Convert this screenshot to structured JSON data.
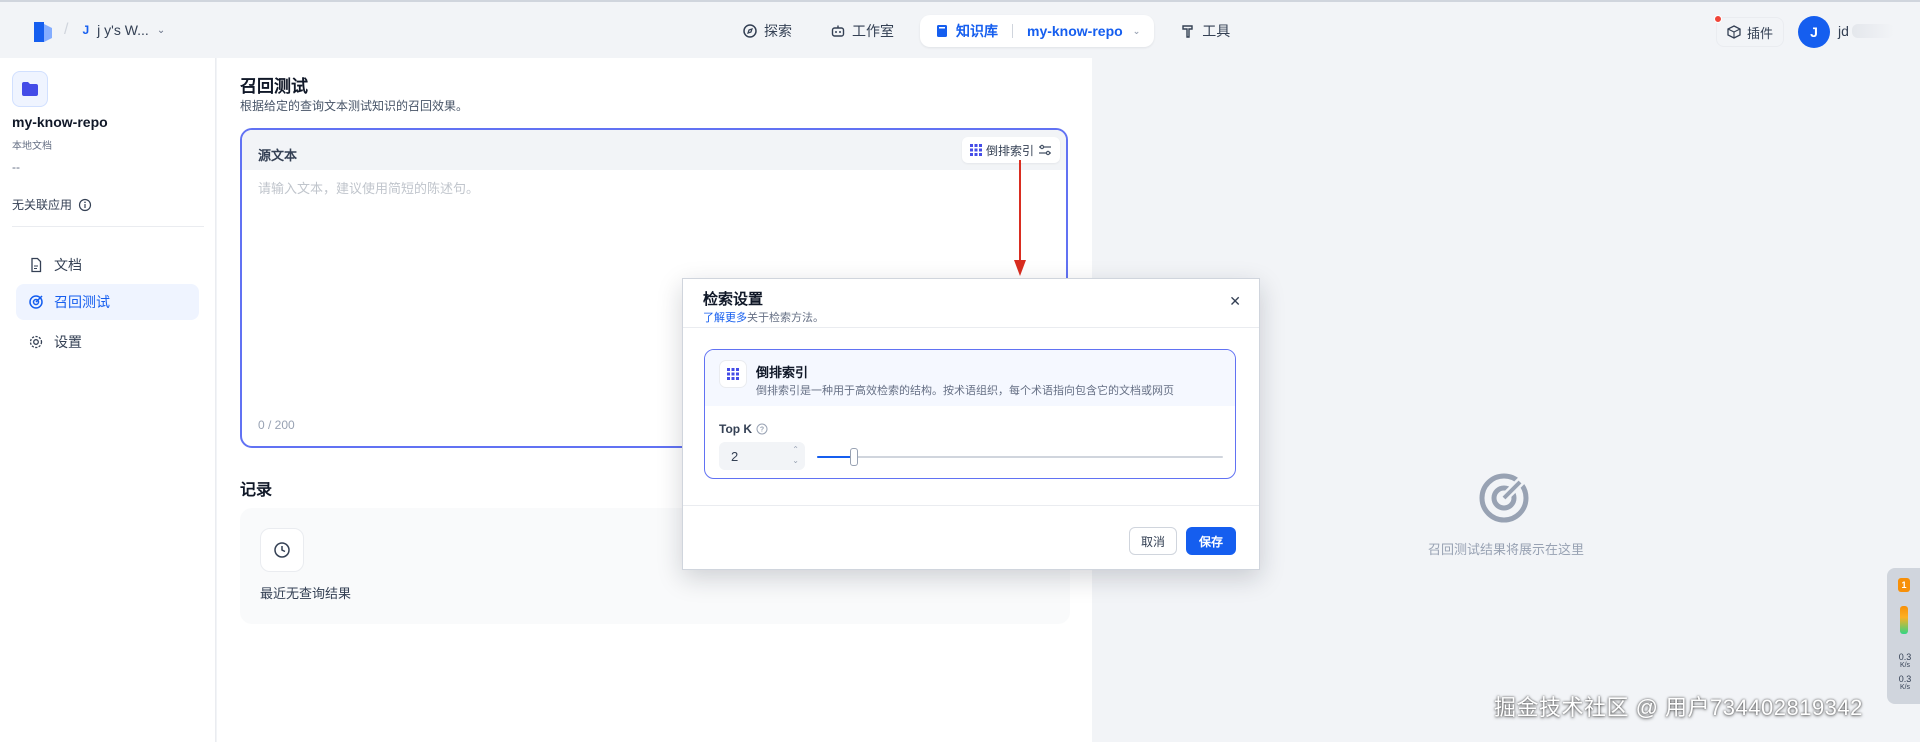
{
  "workspace": {
    "initial": "J",
    "name": "j‌‌   y's W..."
  },
  "nav": {
    "explore": "探索",
    "studio": "工作室",
    "knowledge": "知识库",
    "repo": "my-know-repo",
    "tools": "工具"
  },
  "header": {
    "plugins": "插件",
    "avatar_initial": "J",
    "user_name": "jd"
  },
  "sidebar": {
    "repo_name": "my-know-repo",
    "repo_type": "本地文档",
    "repo_desc": "--",
    "no_app": "无关联应用",
    "items": [
      {
        "label": "文档"
      },
      {
        "label": "召回测试"
      },
      {
        "label": "设置"
      }
    ]
  },
  "main": {
    "title": "召回测试",
    "desc": "根据给定的查询文本测试知识的召回效果。",
    "source_label": "源文本",
    "method_label": "倒排索引",
    "placeholder": "请输入文本，建议使用简短的陈述句。",
    "char_count": "0 / 200",
    "records_title": "记录",
    "records_empty": "最近无查询结果"
  },
  "right_panel": {
    "empty_text": "召回测试结果将展示在这里"
  },
  "modal": {
    "title": "检索设置",
    "learn_more": "了解更多",
    "subtitle": "关于检索方法。",
    "option_name": "倒排索引",
    "option_desc": "倒排索引是一种用于高效检索的结构。按术语组织，每个术语指向包含它的文档或网页",
    "topk_label": "Top K",
    "topk_value": "2",
    "topk_fraction": 0.09,
    "cancel": "取消",
    "save": "保存"
  },
  "edge_widget": {
    "badge": "1",
    "up": "0.3",
    "down": "0.3",
    "unit": "K/s"
  },
  "watermark": "掘金技术社区 @ 用户734402819342",
  "colors": {
    "accent": "#155eef",
    "border_focus": "#6172f3",
    "arrow": "#d92d20"
  }
}
